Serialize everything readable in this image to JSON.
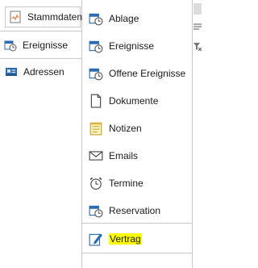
{
  "left_nav": {
    "items": [
      {
        "label": "Stammdaten",
        "icon": "chart-document-icon"
      },
      {
        "label": "Ereignisse",
        "icon": "calendar-clock-icon"
      },
      {
        "label": "Adressen",
        "icon": "address-card-icon"
      }
    ]
  },
  "submenu": {
    "items": [
      {
        "label": "Ablage",
        "icon": "calendar-clock-icon"
      },
      {
        "label": "Ereignisse",
        "icon": "calendar-clock-icon"
      },
      {
        "label": "Offene Ereignisse",
        "icon": "calendar-clock-icon"
      },
      {
        "label": "Dokumente",
        "icon": "document-icon"
      },
      {
        "label": "Notizen",
        "icon": "notepad-icon"
      },
      {
        "label": "Emails",
        "icon": "envelope-icon"
      },
      {
        "label": "Termine",
        "icon": "alarm-clock-icon"
      },
      {
        "label": "Reservation",
        "icon": "calendar-clock-icon"
      },
      {
        "label": "Vertrag",
        "icon": "pen-edit-icon",
        "highlighted": true
      }
    ]
  },
  "toolbar": {
    "icons": [
      "list-filter-icon",
      "clear-filter-icon"
    ]
  },
  "colors": {
    "highlight": "#ffff00",
    "border": "#c8c8c8",
    "icon_blue": "#2b6cb0"
  }
}
